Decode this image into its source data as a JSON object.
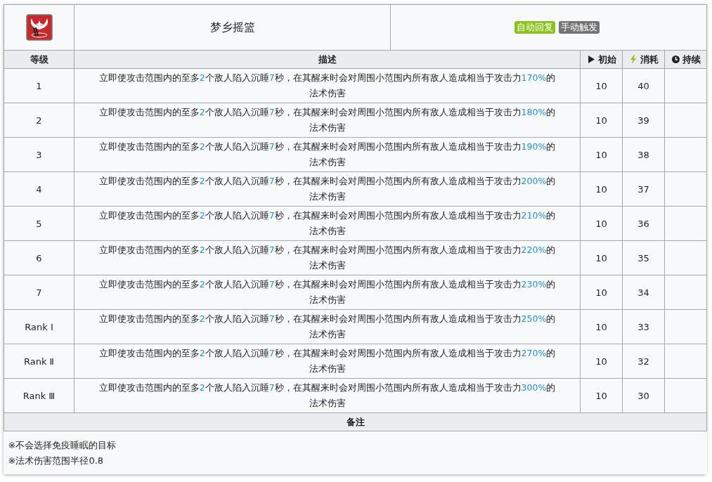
{
  "skill": {
    "name": "梦乡摇篮",
    "tags": [
      {
        "label": "自动回复",
        "color": "#8cc21e"
      },
      {
        "label": "手动触发",
        "color": "#747474"
      }
    ]
  },
  "columns": [
    {
      "label": "等级"
    },
    {
      "label": "描述"
    },
    {
      "label": "初始"
    },
    {
      "label": "消耗"
    },
    {
      "label": "持续"
    }
  ],
  "rows": [
    {
      "level": "1",
      "description": [
        {
          "text": "立即使攻击范围内的至多",
          "highlight": false
        },
        {
          "text": "2",
          "highlight": true
        },
        {
          "text": "个敌人陷入沉睡",
          "highlight": false
        },
        {
          "text": "7",
          "highlight": true
        },
        {
          "text": "秒，在其醒来时会对周围小范围内所有敌人造成相当于攻击力",
          "highlight": false
        },
        {
          "text": "170%",
          "highlight": true
        },
        {
          "text": "的法术伤害",
          "highlight": false
        }
      ],
      "initial": "10",
      "cost": "40"
    },
    {
      "level": "2",
      "description": [
        {
          "text": "立即使攻击范围内的至多",
          "highlight": false
        },
        {
          "text": "2",
          "highlight": true
        },
        {
          "text": "个敌人陷入沉睡",
          "highlight": false
        },
        {
          "text": "7",
          "highlight": true
        },
        {
          "text": "秒，在其醒来时会对周围小范围内所有敌人造成相当于攻击力",
          "highlight": false
        },
        {
          "text": "180%",
          "highlight": true
        },
        {
          "text": "的法术伤害",
          "highlight": false
        }
      ],
      "initial": "10",
      "cost": "39"
    },
    {
      "level": "3",
      "description": [
        {
          "text": "立即使攻击范围内的至多",
          "highlight": false
        },
        {
          "text": "2",
          "highlight": true
        },
        {
          "text": "个敌人陷入沉睡",
          "highlight": false
        },
        {
          "text": "7",
          "highlight": true
        },
        {
          "text": "秒，在其醒来时会对周围小范围内所有敌人造成相当于攻击力",
          "highlight": false
        },
        {
          "text": "190%",
          "highlight": true
        },
        {
          "text": "的法术伤害",
          "highlight": false
        }
      ],
      "initial": "10",
      "cost": "38"
    },
    {
      "level": "4",
      "description": [
        {
          "text": "立即使攻击范围内的至多",
          "highlight": false
        },
        {
          "text": "2",
          "highlight": true
        },
        {
          "text": "个敌人陷入沉睡",
          "highlight": false
        },
        {
          "text": "7",
          "highlight": true
        },
        {
          "text": "秒，在其醒来时会对周围小范围内所有敌人造成相当于攻击力",
          "highlight": false
        },
        {
          "text": "200%",
          "highlight": true
        },
        {
          "text": "的法术伤害",
          "highlight": false
        }
      ],
      "initial": "10",
      "cost": "37"
    },
    {
      "level": "5",
      "description": [
        {
          "text": "立即使攻击范围内的至多",
          "highlight": false
        },
        {
          "text": "2",
          "highlight": true
        },
        {
          "text": "个敌人陷入沉睡",
          "highlight": false
        },
        {
          "text": "7",
          "highlight": true
        },
        {
          "text": "秒，在其醒来时会对周围小范围内所有敌人造成相当于攻击力",
          "highlight": false
        },
        {
          "text": "210%",
          "highlight": true
        },
        {
          "text": "的法术伤害",
          "highlight": false
        }
      ],
      "initial": "10",
      "cost": "36"
    },
    {
      "level": "6",
      "description": [
        {
          "text": "立即使攻击范围内的至多",
          "highlight": false
        },
        {
          "text": "2",
          "highlight": true
        },
        {
          "text": "个敌人陷入沉睡",
          "highlight": false
        },
        {
          "text": "7",
          "highlight": true
        },
        {
          "text": "秒，在其醒来时会对周围小范围内所有敌人造成相当于攻击力",
          "highlight": false
        },
        {
          "text": "220%",
          "highlight": true
        },
        {
          "text": "的法术伤害",
          "highlight": false
        }
      ],
      "initial": "10",
      "cost": "35"
    },
    {
      "level": "7",
      "description": [
        {
          "text": "立即使攻击范围内的至多",
          "highlight": false
        },
        {
          "text": "2",
          "highlight": true
        },
        {
          "text": "个敌人陷入沉睡",
          "highlight": false
        },
        {
          "text": "7",
          "highlight": true
        },
        {
          "text": "秒，在其醒来时会对周围小范围内所有敌人造成相当于攻击力",
          "highlight": false
        },
        {
          "text": "230%",
          "highlight": true
        },
        {
          "text": "的法术伤害",
          "highlight": false
        }
      ],
      "initial": "10",
      "cost": "34"
    },
    {
      "level": "Rank Ⅰ",
      "description": [
        {
          "text": "立即使攻击范围内的至多",
          "highlight": false
        },
        {
          "text": "2",
          "highlight": true
        },
        {
          "text": "个敌人陷入沉睡",
          "highlight": false
        },
        {
          "text": "7",
          "highlight": true
        },
        {
          "text": "秒，在其醒来时会对周围小范围内所有敌人造成相当于攻击力",
          "highlight": false
        },
        {
          "text": "250%",
          "highlight": true
        },
        {
          "text": "的法术伤害",
          "highlight": false
        }
      ],
      "initial": "10",
      "cost": "33"
    },
    {
      "level": "Rank Ⅱ",
      "description": [
        {
          "text": "立即使攻击范围内的至多",
          "highlight": false
        },
        {
          "text": "2",
          "highlight": true
        },
        {
          "text": "个敌人陷入沉睡",
          "highlight": false
        },
        {
          "text": "7",
          "highlight": true
        },
        {
          "text": "秒，在其醒来时会对周围小范围内所有敌人造成相当于攻击力",
          "highlight": false
        },
        {
          "text": "270%",
          "highlight": true
        },
        {
          "text": "的法术伤害",
          "highlight": false
        }
      ],
      "initial": "10",
      "cost": "32"
    },
    {
      "level": "Rank Ⅲ",
      "description": [
        {
          "text": "立即使攻击范围内的至多",
          "highlight": false
        },
        {
          "text": "2",
          "highlight": true
        },
        {
          "text": "个敌人陷入沉睡",
          "highlight": false
        },
        {
          "text": "7",
          "highlight": true
        },
        {
          "text": "秒，在其醒来时会对周围小范围内所有敌人造成相当于攻击力",
          "highlight": false
        },
        {
          "text": "300%",
          "highlight": true
        },
        {
          "text": "的法术伤害",
          "highlight": false
        }
      ],
      "initial": "10",
      "cost": "30"
    }
  ],
  "notes": {
    "title": "备注",
    "lines": [
      "※不会选择免疫睡眠的目标",
      "※法术伤害范围半径0.8"
    ]
  }
}
